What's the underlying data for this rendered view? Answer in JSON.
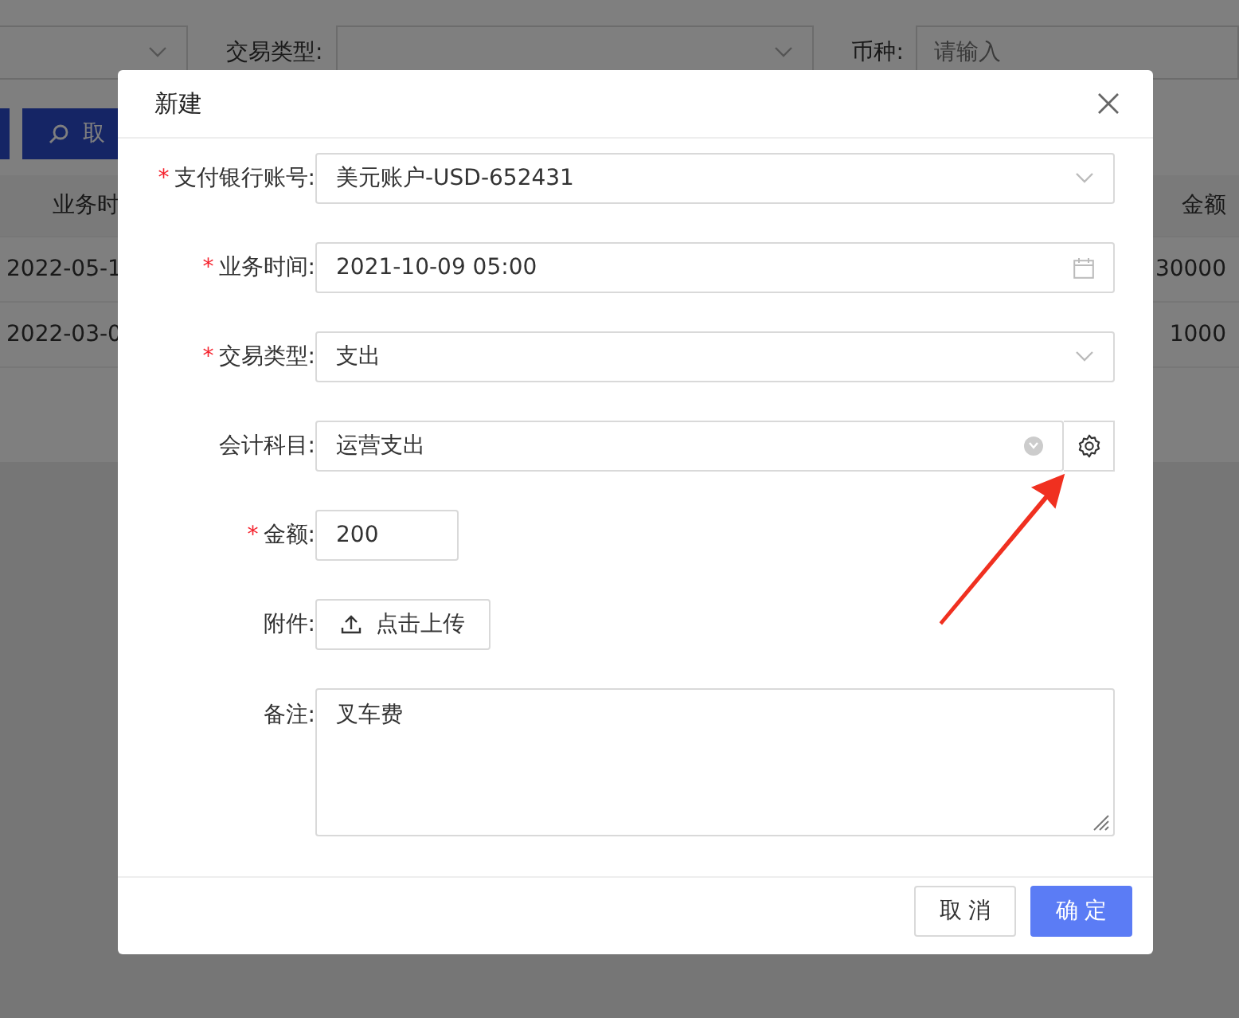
{
  "background": {
    "filters": [
      {
        "kind": "select"
      },
      {
        "kind": "select",
        "label": "交易类型:"
      },
      {
        "kind": "input",
        "label": "币种:",
        "placeholder": "请输入"
      }
    ],
    "buttons": [
      "取"
    ],
    "table": {
      "columns": [
        "业务时",
        "金额"
      ],
      "rows": [
        [
          "2022-05-1",
          "30000"
        ],
        [
          "2022-03-0",
          "1000"
        ]
      ]
    }
  },
  "dialog": {
    "title": "新建",
    "required_mark": "*",
    "fields": [
      {
        "kind": "select",
        "label": "支付银行账号:",
        "required": true,
        "value": "美元账户-USD-652431"
      },
      {
        "kind": "date",
        "label": "业务时间:",
        "required": true,
        "value": "2021-10-09 05:00"
      },
      {
        "kind": "select",
        "label": "交易类型:",
        "required": true,
        "value": "支出"
      },
      {
        "kind": "cascader",
        "label": "会计科目:",
        "required": false,
        "value": "运营支出"
      },
      {
        "kind": "input",
        "label": "金额:",
        "required": true,
        "value": "200"
      },
      {
        "kind": "upload",
        "label": "附件:",
        "required": false,
        "button": "点击上传"
      },
      {
        "kind": "textarea",
        "label": "备注:",
        "required": false,
        "value": "叉车费"
      }
    ],
    "buttons": [
      {
        "kind": "default",
        "label": "取 消"
      },
      {
        "kind": "primary",
        "label": "确 定"
      }
    ]
  }
}
